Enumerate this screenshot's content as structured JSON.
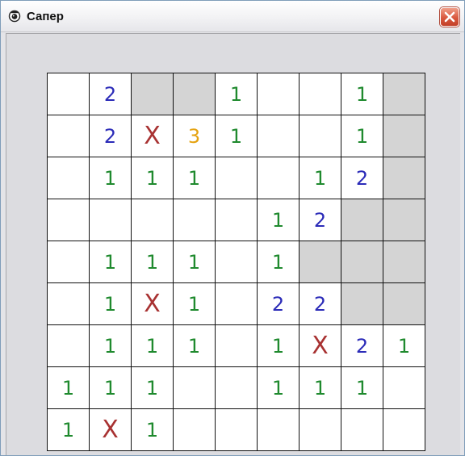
{
  "window": {
    "title": "Сапер",
    "icon": "minesweeper-app-icon",
    "close_icon": "close-icon"
  },
  "colors": {
    "num_1": "#1f8a2e",
    "num_2": "#2b2bb8",
    "num_3": "#e5a20f",
    "mark_x": "#a83232",
    "closed": "#d4d4d4",
    "open": "#ffffff"
  },
  "board": {
    "rows": 9,
    "cols": 9,
    "cells": [
      [
        "",
        "2",
        "#",
        "#",
        "1",
        "",
        "",
        "1",
        "#"
      ],
      [
        "",
        "2",
        "X",
        "3",
        "1",
        "",
        "",
        "1",
        "#"
      ],
      [
        "",
        "1",
        "1",
        "1",
        "",
        "",
        "1",
        "2",
        "#"
      ],
      [
        "",
        "",
        "",
        "",
        "",
        "1",
        "2",
        "#",
        "#"
      ],
      [
        "",
        "1",
        "1",
        "1",
        "",
        "1",
        "#",
        "#",
        "#"
      ],
      [
        "",
        "1",
        "X",
        "1",
        "",
        "2",
        "2",
        "#",
        "#"
      ],
      [
        "",
        "1",
        "1",
        "1",
        "",
        "1",
        "X",
        "2",
        "1"
      ],
      [
        "1",
        "1",
        "1",
        "",
        "",
        "1",
        "1",
        "1",
        ""
      ],
      [
        "1",
        "X",
        "1",
        "",
        "",
        "",
        "",
        "",
        ""
      ]
    ]
  }
}
